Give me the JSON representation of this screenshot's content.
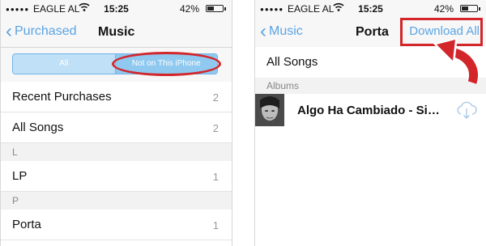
{
  "left": {
    "status": {
      "carrier": "EAGLE AL",
      "time": "15:25",
      "battery": "42%",
      "battery_level": 0.42,
      "signal_icon": "signal-dots-icon",
      "wifi_icon": "wifi-icon"
    },
    "nav": {
      "back_label": "Purchased",
      "title": "Music"
    },
    "segments": [
      {
        "label": "All",
        "selected": false
      },
      {
        "label": "Not on This iPhone",
        "selected": true
      }
    ],
    "rows": [
      {
        "label": "Recent Purchases",
        "count": "2"
      },
      {
        "label": "All Songs",
        "count": "2"
      }
    ],
    "sections": [
      {
        "header": "L",
        "items": [
          {
            "label": "LP",
            "count": "1"
          }
        ]
      },
      {
        "header": "P",
        "items": [
          {
            "label": "Porta",
            "count": "1"
          }
        ]
      }
    ]
  },
  "right": {
    "status": {
      "carrier": "EAGLE AL",
      "time": "15:25",
      "battery": "42%",
      "battery_level": 0.42,
      "signal_icon": "signal-dots-icon",
      "wifi_icon": "wifi-icon"
    },
    "nav": {
      "back_label": "Music",
      "title": "Porta",
      "action_label": "Download All"
    },
    "all_songs_label": "All Songs",
    "albums_header": "Albums",
    "album": {
      "title": "Algo Ha Cambiado - Sin...",
      "icon": "cloud-download-icon"
    }
  },
  "colors": {
    "accent": "#5aa4e3",
    "highlight": "#d2262b"
  }
}
